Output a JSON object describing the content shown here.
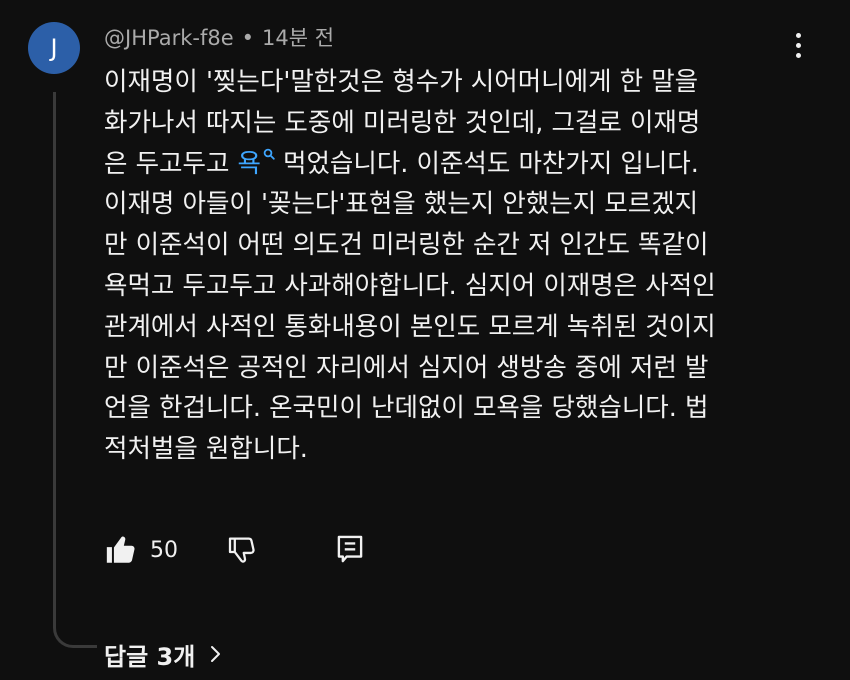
{
  "comment": {
    "avatar_letter": "J",
    "author": "@JHPark-f8e",
    "separator": "•",
    "time": "14분 전",
    "body_lines": [
      "이재명이 '찢는다'말한것은 형수가 시어머니에게 한 말을",
      "화가나서 따지는 도중에 미러링한 것인데, 그걸로 이재명",
      null,
      "이재명 아들이 '꽂는다'표현을 했는지 안했는지 모르겠지",
      "만 이준석이 어떤 의도건 미러링한 순간 저 인간도 똑같이",
      "욕먹고 두고두고 사과해야합니다. 심지어 이재명은 사적인",
      "관계에서 사적인 통화내용이 본인도 모르게 녹취된 것이지",
      "만 이준석은 공적인 자리에서 심지어 생방송 중에 저런 발",
      "언을 한겁니다. 온국민이 난데없이 모욕을 당했습니다. 법",
      "적처벌을 원합니다."
    ],
    "line3_before": "은 두고두고 ",
    "search_term": "욕",
    "line3_after": "먹었습니다. 이준석도 마찬가지 입니다.",
    "like_count": "50",
    "replies_label": "답글 3개"
  },
  "icons": {
    "menu": "more-vert-icon",
    "like": "thumbs-up-icon",
    "dislike": "thumbs-down-icon",
    "reply": "reply-icon",
    "search": "search-icon",
    "chevron": "chevron-right-icon"
  },
  "colors": {
    "background": "#0f0f0f",
    "text": "#f1f1f1",
    "secondary": "#aaaaaa",
    "link": "#3ea6ff",
    "avatar": "#2c5fa8"
  }
}
